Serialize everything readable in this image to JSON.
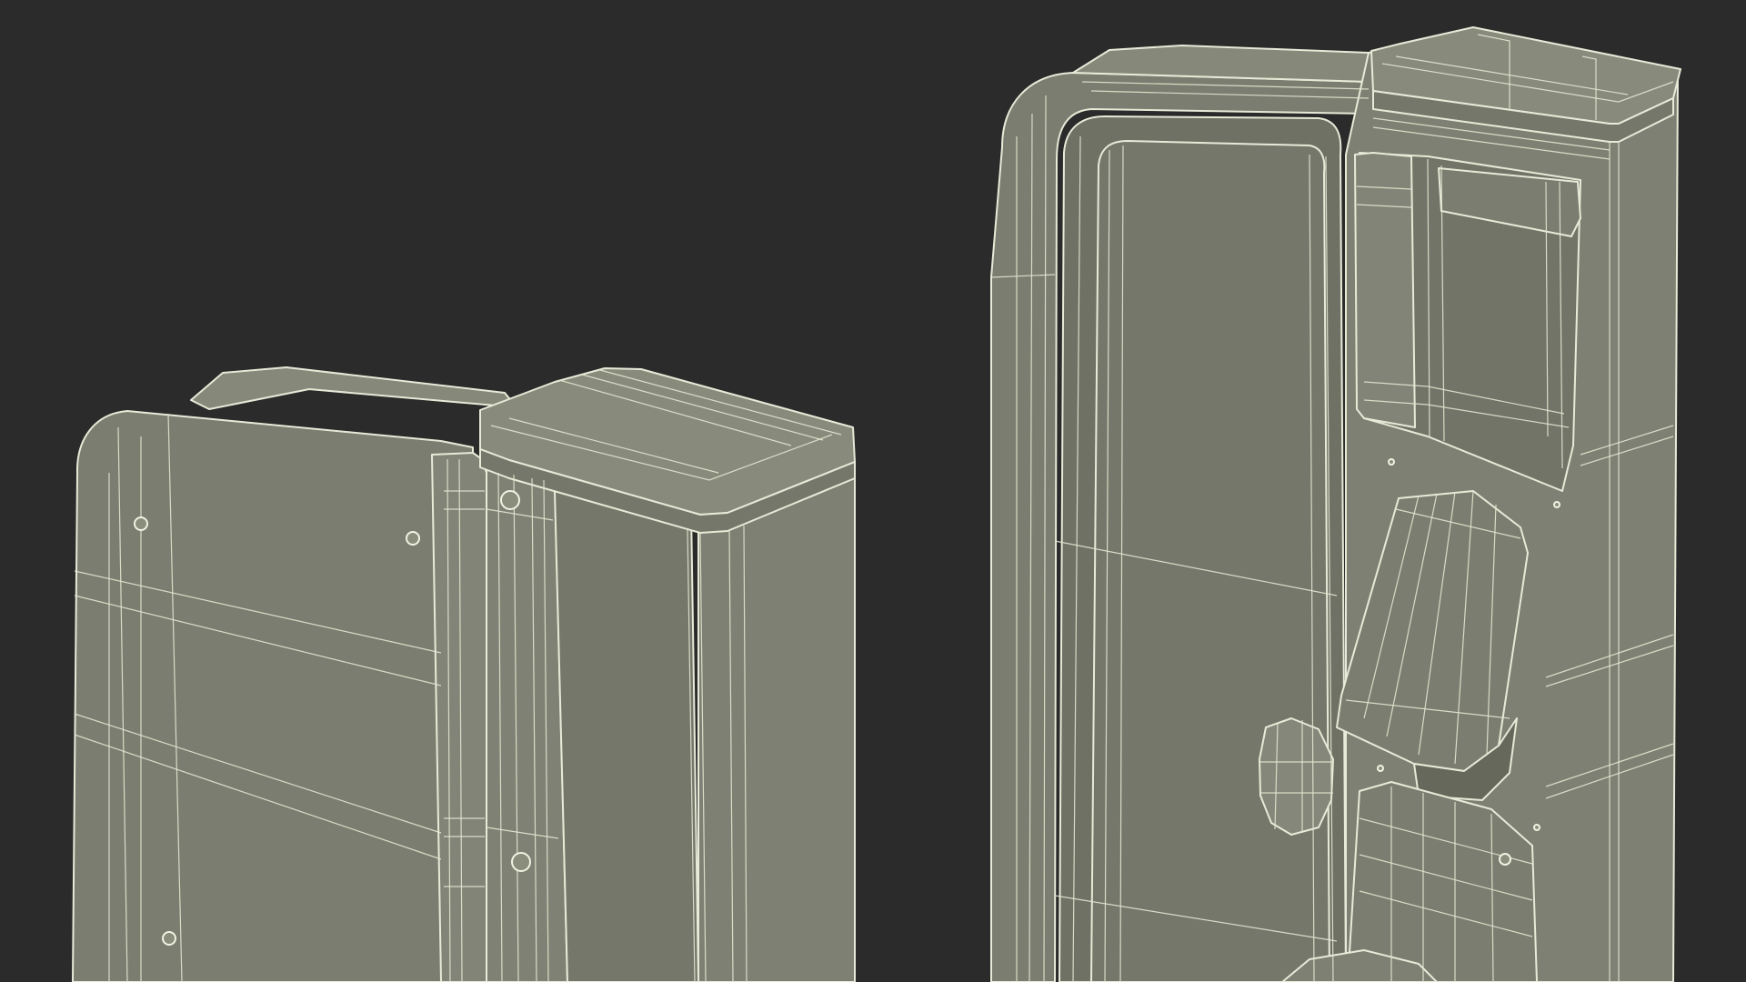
{
  "scene": {
    "background_color": "#2b2b2b",
    "model_fill_color": "#787a6d",
    "model_shadow_color": "#66685c",
    "model_highlight_color": "#8b8d80",
    "wire_color": "#e8ead8",
    "objects": [
      {
        "name": "left-pedestal"
      },
      {
        "name": "right-pedestal"
      }
    ]
  }
}
